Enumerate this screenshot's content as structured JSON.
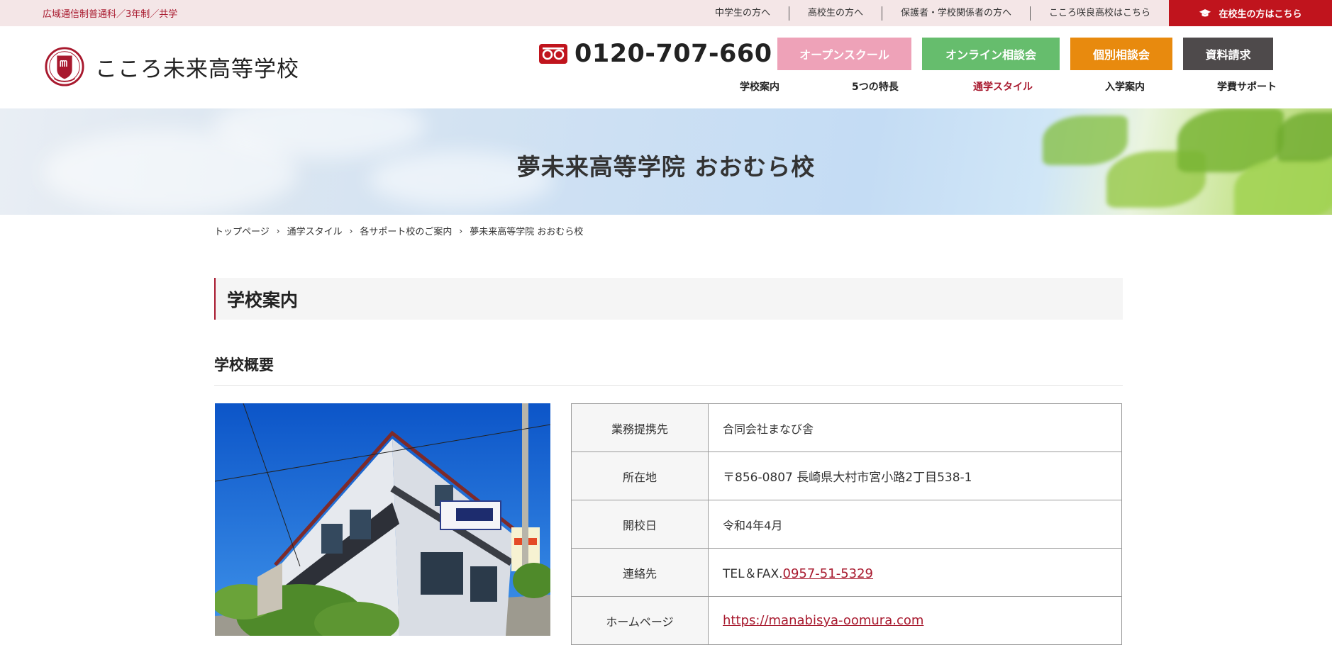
{
  "topbar": {
    "tagline": "広域通信制普通科／3年制／共学",
    "links": [
      "中学生の方へ",
      "高校生の方へ",
      "保護者・学校関係者の方へ",
      "こころ咲良高校はこちら"
    ],
    "student_button": "在校生の方はこちら"
  },
  "header": {
    "school_name": "こころ未来高等学校",
    "phone": "0120-707-660",
    "cta": {
      "open_school": "オープンスクール",
      "online": "オンライン相談会",
      "individual": "個別相談会",
      "documents": "資料請求"
    },
    "nav": [
      "学校案内",
      "5つの特長",
      "通学スタイル",
      "入学案内",
      "学費サポート"
    ],
    "nav_active_index": 2
  },
  "hero": {
    "title": "夢未来高等学院 おおむら校"
  },
  "breadcrumb": [
    "トップページ",
    "通学スタイル",
    "各サポート校のご案内",
    "夢未来高等学院 おおむら校"
  ],
  "section": {
    "title": "学校案内",
    "subtitle": "学校概要"
  },
  "info_table": {
    "rows": [
      {
        "label": "業務提携先",
        "value": "合同会社まなび舎"
      },
      {
        "label": "所在地",
        "value": "〒856-0807 長崎県大村市宮小路2丁目538-1"
      },
      {
        "label": "開校日",
        "value": "令和4年4月"
      },
      {
        "label": "連絡先",
        "prefix": "TEL＆FAX.",
        "value": "0957-51-5329"
      },
      {
        "label": "ホームページ",
        "value": "https://manabisya-oomura.com"
      }
    ]
  },
  "colors": {
    "brand": "#a8192e",
    "topbar_bg": "#f4e6e7",
    "student_button": "#c0141d",
    "open_school": "#eea2b8",
    "online": "#66bd6d",
    "individual": "#e88a0e",
    "documents": "#4e4a4b"
  },
  "icons": {
    "student_button": "graduation-cap-icon",
    "phone": "free-dial-icon",
    "logo": "school-emblem-icon",
    "breadcrumb_separator": "chevron-right-icon"
  }
}
